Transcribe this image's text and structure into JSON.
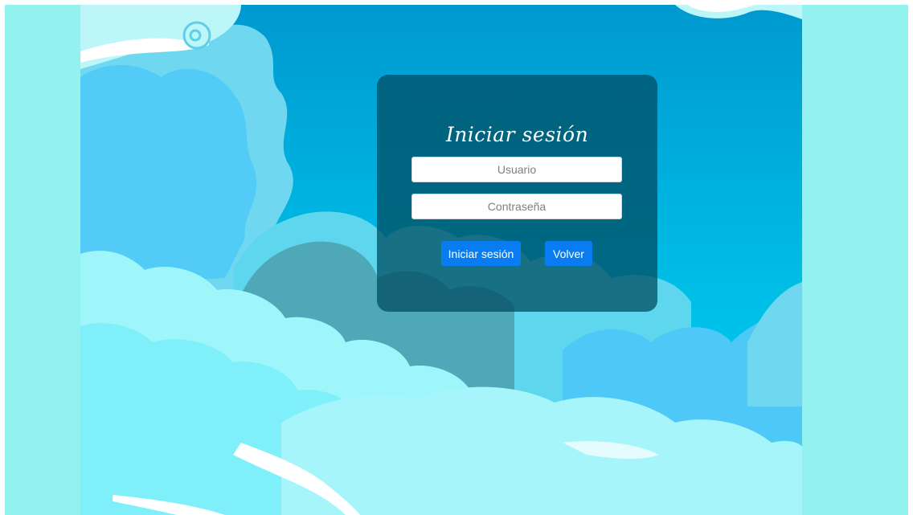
{
  "login": {
    "title": "Iniciar sesión",
    "username_placeholder": "Usuario",
    "password_placeholder": "Contraseña",
    "login_button": "Iniciar sesión",
    "back_button": "Volver"
  },
  "colors": {
    "side_background": "#93f2f0",
    "sky_top": "#009dd1",
    "sky_bottom": "#00c9ec",
    "card_background": "#004c60",
    "button": "#0a7cf2"
  }
}
